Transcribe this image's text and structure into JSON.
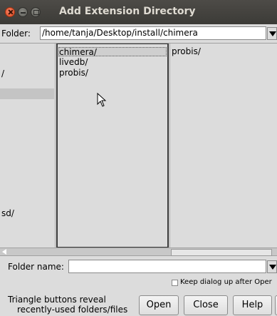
{
  "window": {
    "title": "Add Extension Directory"
  },
  "folder": {
    "label": "Folder:",
    "value": "/home/tanja/Desktop/install/chimera"
  },
  "browser": {
    "column0": [
      "/",
      "sd/"
    ],
    "column1": [
      "chimera/",
      "livedb/",
      "probis/"
    ],
    "column2": [
      "probis/"
    ],
    "selected": "chimera/"
  },
  "folder_name": {
    "label": "Folder name:",
    "value": ""
  },
  "options": {
    "keep_open_label": "Keep dialog up after Oper",
    "keep_open_checked": false
  },
  "hint": {
    "line1": "Triangle buttons reveal",
    "line2": "recently-used folders/files"
  },
  "buttons": {
    "open": "Open",
    "close": "Close",
    "help": "Help",
    "extra": "I"
  },
  "icons": {
    "close": "close-icon",
    "minimize": "minimize-icon",
    "maximize": "maximize-icon",
    "menu": "triangle-down-icon",
    "cursor": "mouse-pointer-icon"
  }
}
